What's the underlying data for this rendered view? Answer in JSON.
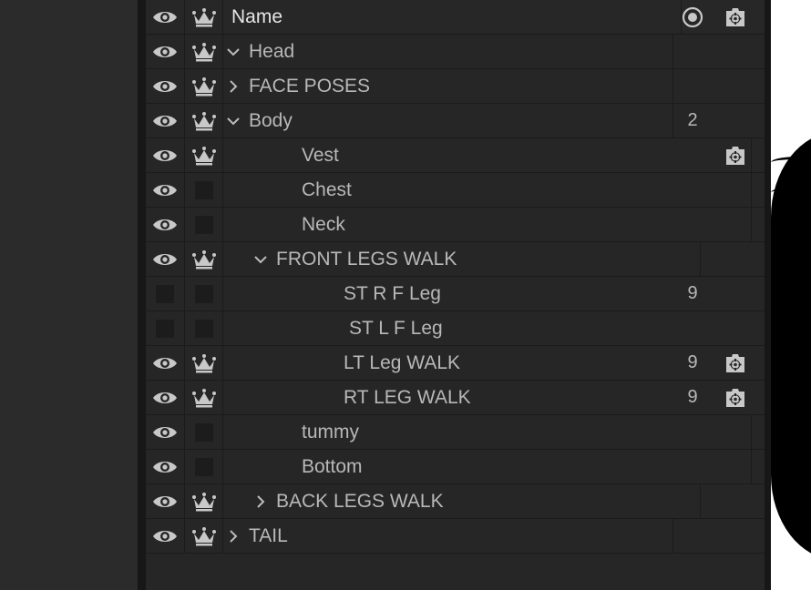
{
  "layers_panel": {
    "columns": {
      "name": "Name"
    },
    "rows": [
      {
        "name": "Head",
        "count": "",
        "eye": true,
        "crown": true,
        "gear": false,
        "chevron": "down"
      },
      {
        "name": "FACE POSES",
        "count": "",
        "eye": true,
        "crown": true,
        "gear": false,
        "chevron": "right"
      },
      {
        "name": "Body",
        "count": "2",
        "eye": true,
        "crown": true,
        "gear": false,
        "chevron": "down"
      },
      {
        "name": "Vest",
        "count": "",
        "eye": true,
        "crown": true,
        "gear": true,
        "chevron": ""
      },
      {
        "name": "Chest",
        "count": "",
        "eye": true,
        "crown": false,
        "gear": false,
        "chevron": ""
      },
      {
        "name": "Neck",
        "count": "",
        "eye": true,
        "crown": false,
        "gear": false,
        "chevron": ""
      },
      {
        "name": "FRONT LEGS WALK",
        "count": "",
        "eye": true,
        "crown": true,
        "gear": false,
        "chevron": "down"
      },
      {
        "name": "ST R F Leg",
        "count": "9",
        "eye": false,
        "crown": false,
        "gear": false,
        "chevron": ""
      },
      {
        "name": "ST L F Leg",
        "count": "",
        "eye": false,
        "crown": false,
        "gear": false,
        "chevron": ""
      },
      {
        "name": "LT Leg WALK",
        "count": "9",
        "eye": true,
        "crown": true,
        "gear": true,
        "chevron": ""
      },
      {
        "name": "RT LEG WALK",
        "count": "9",
        "eye": true,
        "crown": true,
        "gear": true,
        "chevron": ""
      },
      {
        "name": "tummy",
        "count": "",
        "eye": true,
        "crown": false,
        "gear": false,
        "chevron": ""
      },
      {
        "name": "Bottom",
        "count": "",
        "eye": true,
        "crown": false,
        "gear": false,
        "chevron": ""
      },
      {
        "name": "BACK LEGS WALK",
        "count": "",
        "eye": true,
        "crown": true,
        "gear": false,
        "chevron": "right"
      },
      {
        "name": "TAIL",
        "count": "",
        "eye": true,
        "crown": true,
        "gear": false,
        "chevron": "right"
      }
    ]
  },
  "icons": {
    "eye": "eye-icon",
    "crown": "crown-icon",
    "gear": "gear-icon",
    "record": "record-icon",
    "chevron_down": "chevron-down-icon",
    "chevron_right": "chevron-right-icon"
  },
  "colors": {
    "panel_bg": "#262626",
    "text": "#b8b8b8",
    "header_text": "#e6e6e6",
    "icon": "#c8c8c8",
    "canvas": "#ffffff"
  }
}
